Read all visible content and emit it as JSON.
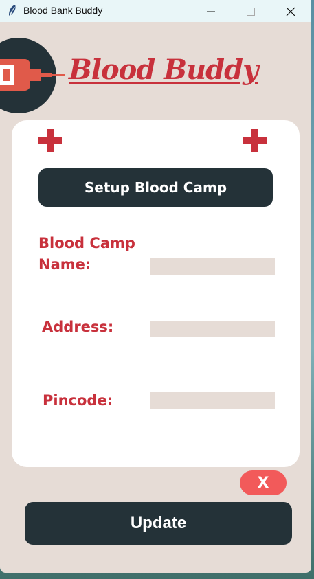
{
  "window": {
    "title": "Blood Bank Buddy",
    "app_icon": "feather-icon",
    "controls": [
      "minimize-icon",
      "maximize-icon",
      "close-icon"
    ]
  },
  "header": {
    "brand": "Blood Buddy",
    "logo_icon": "blood-bag-syringe-icon"
  },
  "form": {
    "decorations": [
      "plus-icon",
      "plus-icon"
    ],
    "setup_button": "Setup Blood Camp",
    "fields": {
      "camp_name_label": "Blood Camp Name:",
      "camp_name_value": "",
      "address_label": "Address:",
      "address_value": "",
      "pincode_label": "Pincode:",
      "pincode_value": ""
    }
  },
  "actions": {
    "close_label": "X",
    "update_label": "Update"
  },
  "colors": {
    "accent_red": "#c8313c",
    "dark": "#243238",
    "background": "#e6dcd6",
    "close_button": "#f25a5a"
  }
}
